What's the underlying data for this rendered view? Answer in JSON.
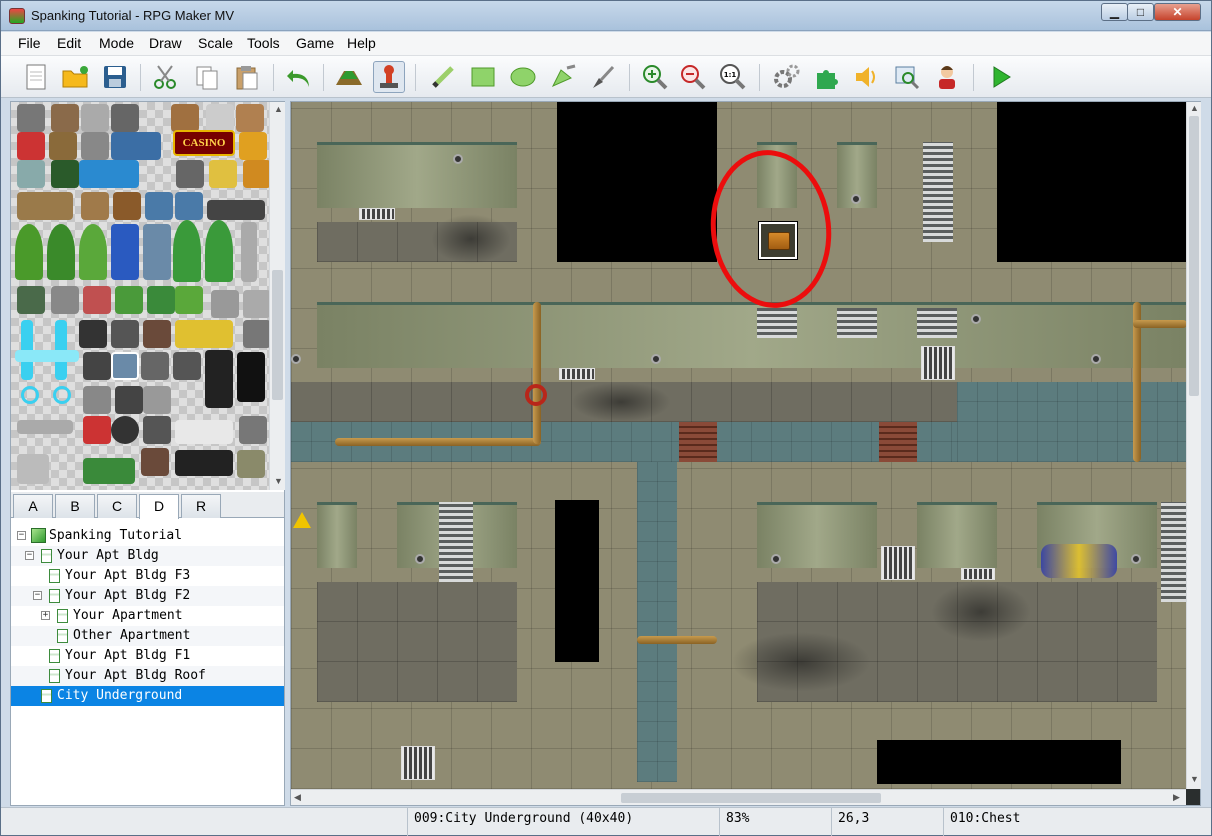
{
  "window": {
    "title": "Spanking Tutorial - RPG Maker MV",
    "controls": {
      "minimize": "▁",
      "maximize": "□",
      "close": "✕"
    }
  },
  "menu": [
    "File",
    "Edit",
    "Mode",
    "Draw",
    "Scale",
    "Tools",
    "Game",
    "Help"
  ],
  "toolbar": {
    "icons": [
      "new-project-icon",
      "open-project-icon",
      "save-project-icon",
      "cut-icon",
      "copy-icon",
      "paste-icon",
      "undo-icon",
      "map-mode-icon",
      "event-mode-icon",
      "pencil-icon",
      "rectangle-icon",
      "ellipse-icon",
      "flood-fill-icon",
      "shadow-pen-icon",
      "zoom-in-icon",
      "zoom-out-icon",
      "actual-size-icon",
      "database-icon",
      "plugin-manager-icon",
      "sound-test-icon",
      "event-searcher-icon",
      "character-generator-icon",
      "playtest-icon"
    ],
    "actual_size_label": "1:1"
  },
  "tileset": {
    "casino_sign": "CASINO",
    "tabs": [
      "A",
      "B",
      "C",
      "D",
      "R"
    ],
    "active_tab": "D"
  },
  "tree": [
    {
      "label": "Spanking Tutorial",
      "level": 0,
      "expander": "−"
    },
    {
      "label": "Your Apt Bldg",
      "level": 1,
      "expander": "−"
    },
    {
      "label": "Your Apt Bldg F3",
      "level": 2,
      "expander": ""
    },
    {
      "label": "Your Apt Bldg F2",
      "level": 2,
      "expander": "−"
    },
    {
      "label": "Your Apartment",
      "level": 3,
      "expander": "+"
    },
    {
      "label": "Other Apartment",
      "level": 3,
      "expander": ""
    },
    {
      "label": "Your Apt Bldg F1",
      "level": 2,
      "expander": ""
    },
    {
      "label": "Your Apt Bldg Roof",
      "level": 2,
      "expander": ""
    },
    {
      "label": "City Underground",
      "level": 1,
      "expander": ""
    }
  ],
  "selected_map": "City Underground",
  "status": {
    "map": "009:City Underground (40x40)",
    "zoom": "83%",
    "coords": "26,3",
    "event": "010:Chest"
  },
  "colors": {
    "accent": "#0b84e4",
    "annotation": "#ec0d0d"
  }
}
